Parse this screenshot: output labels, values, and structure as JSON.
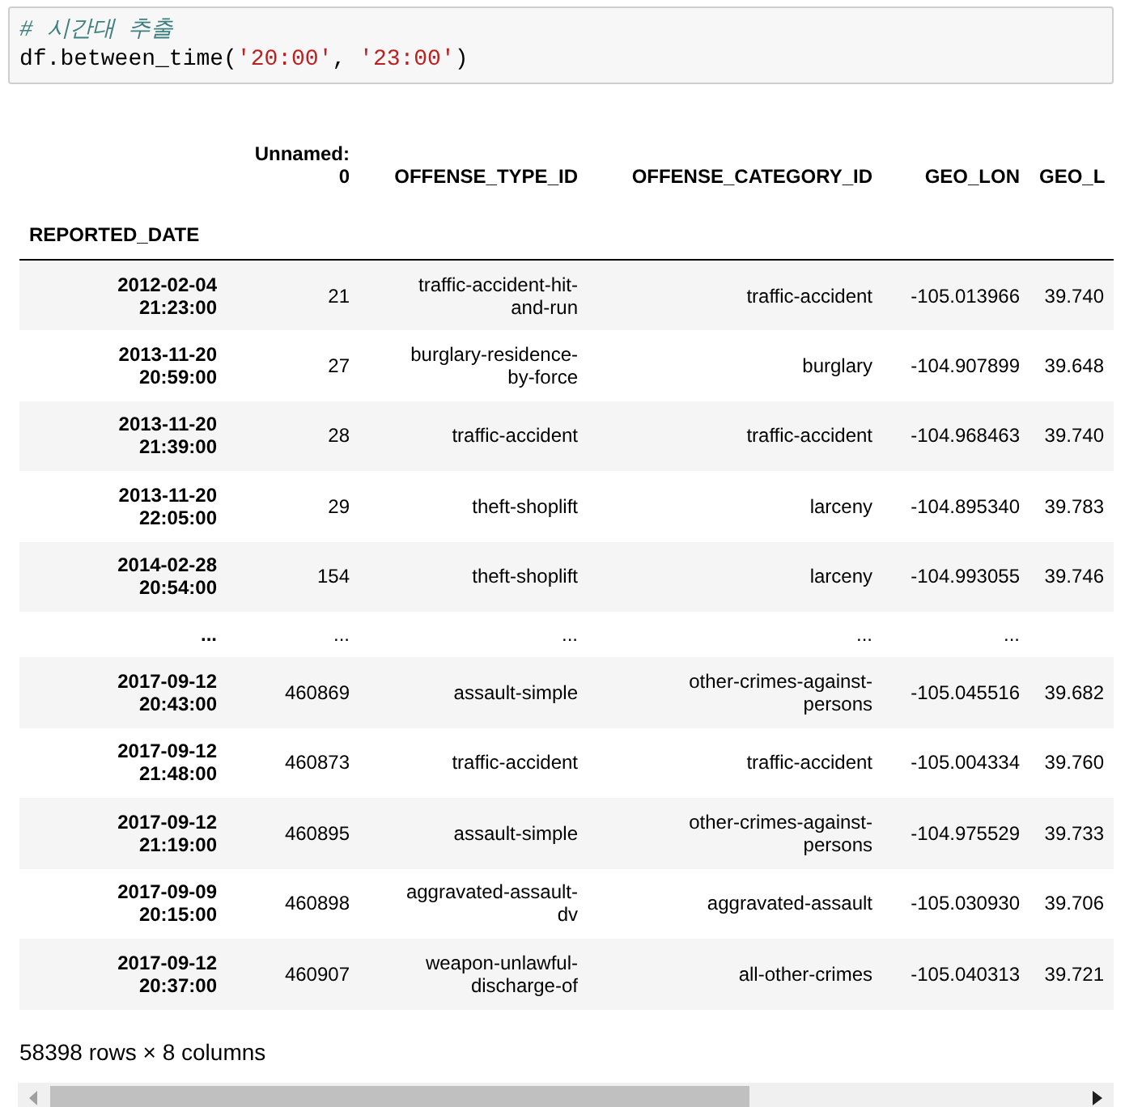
{
  "code_cell": {
    "comment": "# 시간대 추출",
    "tokens": [
      {
        "kind": "plain",
        "text": "df.between_time("
      },
      {
        "kind": "string",
        "text": "'20:00'"
      },
      {
        "kind": "plain",
        "text": ", "
      },
      {
        "kind": "string",
        "text": "'23:00'"
      },
      {
        "kind": "plain",
        "text": ")"
      }
    ]
  },
  "table": {
    "columns": [
      "Unnamed: 0",
      "OFFENSE_TYPE_ID",
      "OFFENSE_CATEGORY_ID",
      "GEO_LON",
      "GEO_L"
    ],
    "index_name": "REPORTED_DATE",
    "rows": [
      {
        "index": "2012-02-04 21:23:00",
        "cells": [
          "21",
          "traffic-accident-hit-and-run",
          "traffic-accident",
          "-105.013966",
          "39.740"
        ]
      },
      {
        "index": "2013-11-20 20:59:00",
        "cells": [
          "27",
          "burglary-residence-by-force",
          "burglary",
          "-104.907899",
          "39.648"
        ]
      },
      {
        "index": "2013-11-20 21:39:00",
        "cells": [
          "28",
          "traffic-accident",
          "traffic-accident",
          "-104.968463",
          "39.740"
        ]
      },
      {
        "index": "2013-11-20 22:05:00",
        "cells": [
          "29",
          "theft-shoplift",
          "larceny",
          "-104.895340",
          "39.783"
        ]
      },
      {
        "index": "2014-02-28 20:54:00",
        "cells": [
          "154",
          "theft-shoplift",
          "larceny",
          "-104.993055",
          "39.746"
        ]
      },
      {
        "index": "...",
        "cells": [
          "...",
          "...",
          "...",
          "..."
        ]
      },
      {
        "index": "2017-09-12 20:43:00",
        "cells": [
          "460869",
          "assault-simple",
          "other-crimes-against-persons",
          "-105.045516",
          "39.682"
        ]
      },
      {
        "index": "2017-09-12 21:48:00",
        "cells": [
          "460873",
          "traffic-accident",
          "traffic-accident",
          "-105.004334",
          "39.760"
        ]
      },
      {
        "index": "2017-09-12 21:19:00",
        "cells": [
          "460895",
          "assault-simple",
          "other-crimes-against-persons",
          "-104.975529",
          "39.733"
        ]
      },
      {
        "index": "2017-09-09 20:15:00",
        "cells": [
          "460898",
          "aggravated-assault-dv",
          "aggravated-assault",
          "-105.030930",
          "39.706"
        ]
      },
      {
        "index": "2017-09-12 20:37:00",
        "cells": [
          "460907",
          "weapon-unlawful-discharge-of",
          "all-other-crimes",
          "-105.040313",
          "39.721"
        ]
      }
    ]
  },
  "shape_note": "58398 rows × 8 columns"
}
